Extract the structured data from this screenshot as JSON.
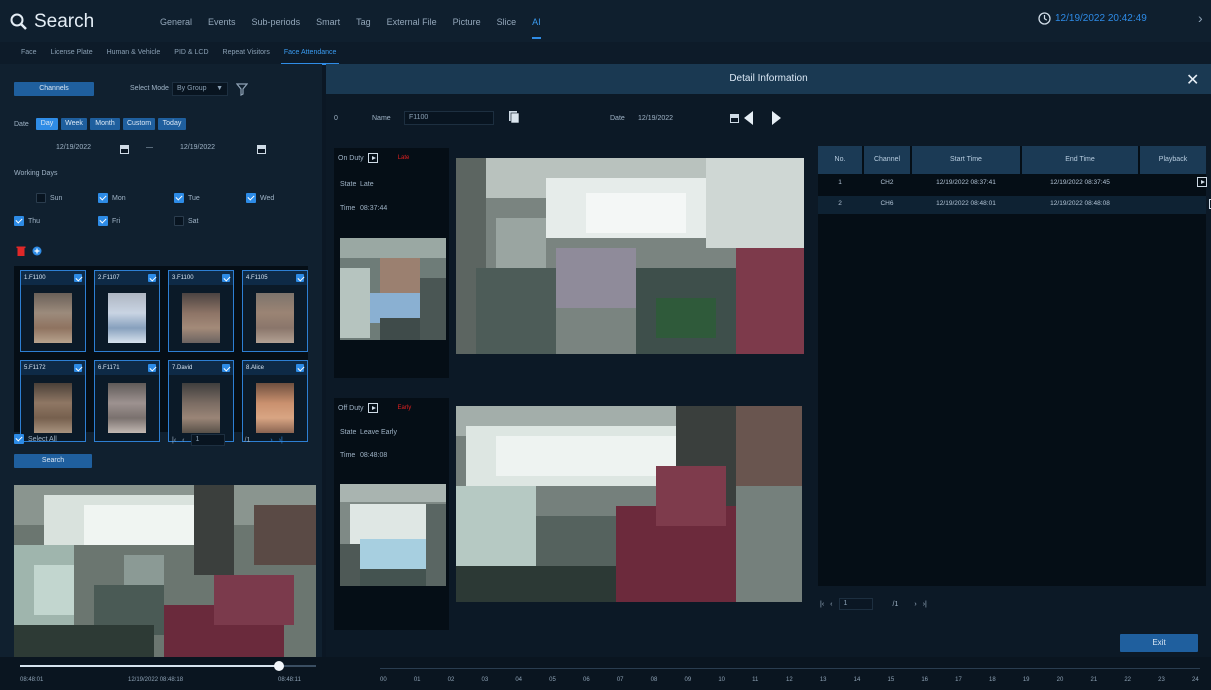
{
  "header": {
    "app_title": "Search",
    "tabs": [
      "General",
      "Events",
      "Sub-periods",
      "Smart",
      "Tag",
      "External File",
      "Picture",
      "Slice",
      "AI"
    ],
    "active_tab": "AI",
    "datetime": "12/19/2022 20:42:49"
  },
  "subtabs": {
    "items": [
      "Face",
      "License Plate",
      "Human & Vehicle",
      "PID & LCD",
      "Repeat Visitors",
      "Face Attendance"
    ],
    "active": "Face Attendance"
  },
  "left": {
    "channels_label": "Channels",
    "select_mode_label": "Select Mode",
    "select_mode_value": "By Group",
    "date_label": "Date",
    "date_buttons": [
      "Day",
      "Week",
      "Month",
      "Custom",
      "Today"
    ],
    "date_from": "12/19/2022",
    "date_to": "12/19/2022",
    "date_sep": "—",
    "working_days_label": "Working Days",
    "days": [
      {
        "label": "Sun",
        "checked": false
      },
      {
        "label": "Mon",
        "checked": true
      },
      {
        "label": "Tue",
        "checked": true
      },
      {
        "label": "Wed",
        "checked": true
      },
      {
        "label": "Thu",
        "checked": true
      },
      {
        "label": "Fri",
        "checked": true
      },
      {
        "label": "Sat",
        "checked": false
      }
    ],
    "faces": [
      "1.F1100",
      "2.F1107",
      "3.F1100",
      "4.F1105",
      "5.F1172",
      "6.F1171",
      "7.David",
      "8.Alice"
    ],
    "select_all_label": "Select All",
    "pager": {
      "current": "1",
      "total": "/1"
    },
    "search_label": "Search",
    "preview_time_left": "08:48:01",
    "preview_time_mid": "12/19/2022 08:48:18",
    "preview_time_right": "08:48:11"
  },
  "modal": {
    "title": "Detail Information",
    "id_label": "0",
    "name_label": "Name",
    "name_value": "F1100",
    "date_label": "Date",
    "date_value": "12/19/2022",
    "on_duty": {
      "label": "On Duty",
      "state_label": "State",
      "state_value": "Late",
      "time_label": "Time",
      "time_value": "08:37:44",
      "tag": "Late"
    },
    "off_duty": {
      "label": "Off Duty",
      "state_label": "State",
      "state_value": "Leave Early",
      "time_label": "Time",
      "time_value": "08:48:08",
      "tag": "Early"
    },
    "table": {
      "headers": [
        "No.",
        "Channel",
        "Start Time",
        "End Time",
        "Playback"
      ],
      "rows": [
        {
          "no": "1",
          "channel": "CH2",
          "start": "12/19/2022 08:37:41",
          "end": "12/19/2022 08:37:45"
        },
        {
          "no": "2",
          "channel": "CH6",
          "start": "12/19/2022 08:48:01",
          "end": "12/19/2022 08:48:08"
        }
      ]
    },
    "pager": {
      "current": "1",
      "total": "/1"
    },
    "exit_label": "Exit"
  },
  "timeline": {
    "hours": [
      "00",
      "01",
      "02",
      "03",
      "04",
      "05",
      "06",
      "07",
      "08",
      "09",
      "10",
      "11",
      "12",
      "13",
      "14",
      "15",
      "16",
      "17",
      "18",
      "19",
      "20",
      "21",
      "22",
      "23",
      "24"
    ]
  },
  "colors": {
    "accent": "#2f8ce6",
    "header_bg": "#0f1f2e",
    "modal_bar": "#1a3952",
    "warning": "#e02020"
  }
}
